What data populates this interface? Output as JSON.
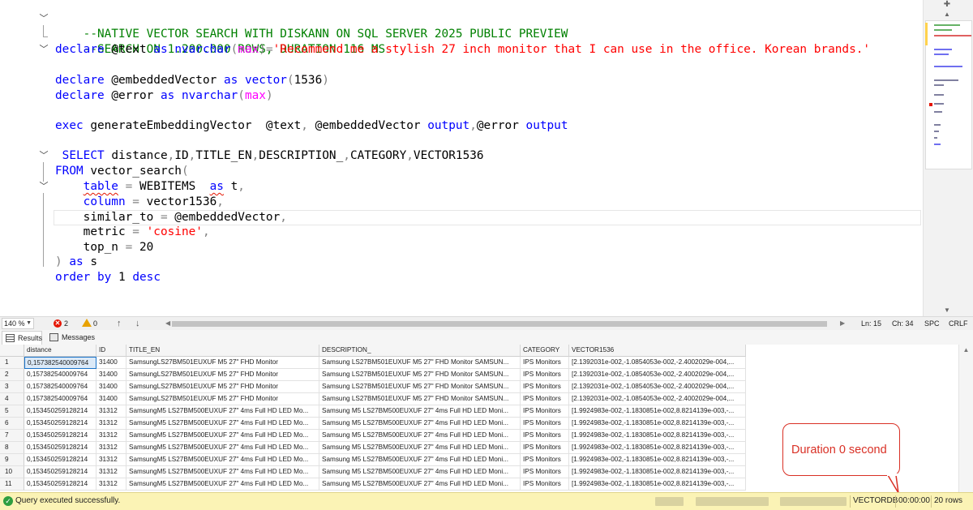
{
  "editor": {
    "comment1": "--NATIVE VECTOR SEARCH WITH DISKANN ON SQL SERVER 2025 PUBLIC PREVIEW",
    "comment2": "--SEARCH ON 1.200.000 ROWS, DURATION 116 MS",
    "line3": {
      "kw1": "declare",
      "var": " @text ",
      "kw2": "as",
      "sp": " ",
      "type": "nvarchar",
      "p1": "(",
      "fn": "max",
      "p2": ")=",
      "str": "'Recommend me a stylish 27 inch monitor that I can use in the office. Korean brands.'"
    },
    "line4": {
      "kw1": "declare",
      "var": " @embeddedVector ",
      "kw2": "as",
      "sp": " ",
      "type": "vector",
      "p1": "(",
      "num": "1536",
      "p2": ")"
    },
    "line5": {
      "kw1": "declare",
      "var": " @error ",
      "kw2": "as",
      "sp": " ",
      "type": "nvarchar",
      "p1": "(",
      "fn": "max",
      "p2": ")"
    },
    "line6": {
      "kw1": "exec",
      "proc": " generateEmbeddingVector  @text",
      "c1": ",",
      "v2": " @embeddedVector ",
      "kw2": "output",
      "c2": ",",
      "v3": "@error ",
      "kw3": "output"
    },
    "line7": {
      "kw1": " SELECT",
      "cols": " distance",
      "c1": ",",
      "a": "ID",
      "c2": ",",
      "b": "TITLE_EN",
      "c3": ",",
      "c": "DESCRIPTION_",
      "c4": ",",
      "d": "CATEGORY",
      "c5": ",",
      "e": "VECTOR1536"
    },
    "line8": {
      "kw1": "FROM",
      "fn": " vector_search",
      "p": "("
    },
    "line9": {
      "indent": "    ",
      "kw1": "table",
      "eq": " = ",
      "name": "WEBITEMS",
      "sp": "  ",
      "kw2": "as",
      "alias": " t",
      "c": ","
    },
    "line10": {
      "indent": "    ",
      "kw1": "column",
      "eq": " = ",
      "name": "vector1536",
      "c": ","
    },
    "line11": {
      "indent": "    ",
      "name": "similar_to",
      "eq": " = ",
      "var": "@embeddedVector",
      "c": ","
    },
    "line12": {
      "indent": "    ",
      "name": "metric",
      "eq": " = ",
      "str": "'cosine'",
      "c": ","
    },
    "line13": {
      "indent": "    ",
      "name": "top_n",
      "eq": " = ",
      "num": "20"
    },
    "line14": {
      "p": ") ",
      "kw1": "as",
      "alias": " s"
    },
    "line15": {
      "kw1": "order",
      "sp": " ",
      "kw2": "by",
      "num": " 1 ",
      "kw3": "desc"
    }
  },
  "editor_status": {
    "zoom": "140 %",
    "errors": "2",
    "warnings": "0",
    "ln": "Ln: 15",
    "ch": "Ch: 34",
    "spc": "SPC",
    "crlf": "CRLF"
  },
  "tabs": {
    "results": "Results",
    "messages": "Messages"
  },
  "grid": {
    "columns": [
      "distance",
      "ID",
      "TITLE_EN",
      "DESCRIPTION_",
      "CATEGORY",
      "VECTOR1536"
    ],
    "rows": [
      {
        "n": "1",
        "distance": "0,157382540009764",
        "id": "31400",
        "title": "SamsungLS27BM501EUXUF M5 27\" FHD Monitor",
        "desc": "Samsung LS27BM501EUXUF M5 27\" FHD Monitor SAMSUN...",
        "cat": "IPS Monitors",
        "vec": "[2.1392031e-002,-1.0854053e-002,-2.4002029e-004,..."
      },
      {
        "n": "2",
        "distance": "0,157382540009764",
        "id": "31400",
        "title": "SamsungLS27BM501EUXUF M5 27\" FHD Monitor",
        "desc": "Samsung LS27BM501EUXUF M5 27\" FHD Monitor SAMSUN...",
        "cat": "IPS Monitors",
        "vec": "[2.1392031e-002,-1.0854053e-002,-2.4002029e-004,..."
      },
      {
        "n": "3",
        "distance": "0,157382540009764",
        "id": "31400",
        "title": "SamsungLS27BM501EUXUF M5 27\" FHD Monitor",
        "desc": "Samsung LS27BM501EUXUF M5 27\" FHD Monitor SAMSUN...",
        "cat": "IPS Monitors",
        "vec": "[2.1392031e-002,-1.0854053e-002,-2.4002029e-004,..."
      },
      {
        "n": "4",
        "distance": "0,157382540009764",
        "id": "31400",
        "title": "SamsungLS27BM501EUXUF M5 27\" FHD Monitor",
        "desc": "Samsung LS27BM501EUXUF M5 27\" FHD Monitor SAMSUN...",
        "cat": "IPS Monitors",
        "vec": "[2.1392031e-002,-1.0854053e-002,-2.4002029e-004,..."
      },
      {
        "n": "5",
        "distance": "0,153450259128214",
        "id": "31312",
        "title": "SamsungM5 LS27BM500EUXUF 27\" 4ms Full HD LED Mo...",
        "desc": "Samsung M5 LS27BM500EUXUF 27\" 4ms Full HD LED Moni...",
        "cat": "IPS Monitors",
        "vec": "[1.9924983e-002,-1.1830851e-002,8.8214139e-003,-..."
      },
      {
        "n": "6",
        "distance": "0,153450259128214",
        "id": "31312",
        "title": "SamsungM5 LS27BM500EUXUF 27\" 4ms Full HD LED Mo...",
        "desc": "Samsung M5 LS27BM500EUXUF 27\" 4ms Full HD LED Moni...",
        "cat": "IPS Monitors",
        "vec": "[1.9924983e-002,-1.1830851e-002,8.8214139e-003,-..."
      },
      {
        "n": "7",
        "distance": "0,153450259128214",
        "id": "31312",
        "title": "SamsungM5 LS27BM500EUXUF 27\" 4ms Full HD LED Mo...",
        "desc": "Samsung M5 LS27BM500EUXUF 27\" 4ms Full HD LED Moni...",
        "cat": "IPS Monitors",
        "vec": "[1.9924983e-002,-1.1830851e-002,8.8214139e-003,-..."
      },
      {
        "n": "8",
        "distance": "0,153450259128214",
        "id": "31312",
        "title": "SamsungM5 LS27BM500EUXUF 27\" 4ms Full HD LED Mo...",
        "desc": "Samsung M5 LS27BM500EUXUF 27\" 4ms Full HD LED Moni...",
        "cat": "IPS Monitors",
        "vec": "[1.9924983e-002,-1.1830851e-002,8.8214139e-003,-..."
      },
      {
        "n": "9",
        "distance": "0,153450259128214",
        "id": "31312",
        "title": "SamsungM5 LS27BM500EUXUF 27\" 4ms Full HD LED Mo...",
        "desc": "Samsung M5 LS27BM500EUXUF 27\" 4ms Full HD LED Moni...",
        "cat": "IPS Monitors",
        "vec": "[1.9924983e-002,-1.1830851e-002,8.8214139e-003,-..."
      },
      {
        "n": "10",
        "distance": "0,153450259128214",
        "id": "31312",
        "title": "SamsungM5 LS27BM500EUXUF 27\" 4ms Full HD LED Mo...",
        "desc": "Samsung M5 LS27BM500EUXUF 27\" 4ms Full HD LED Moni...",
        "cat": "IPS Monitors",
        "vec": "[1.9924983e-002,-1.1830851e-002,8.8214139e-003,-..."
      },
      {
        "n": "11",
        "distance": "0,153450259128214",
        "id": "31312",
        "title": "SamsungM5 LS27BM500EUXUF 27\" 4ms Full HD LED Mo...",
        "desc": "Samsung M5 LS27BM500EUXUF 27\" 4ms Full HD LED Moni...",
        "cat": "IPS Monitors",
        "vec": "[1.9924983e-002,-1.1830851e-002,8.8214139e-003,-..."
      }
    ]
  },
  "callout": {
    "text": "Duration 0 second"
  },
  "statusbar": {
    "message": "Query executed successfully.",
    "database": "VECTORDB",
    "elapsed": "00:00:00",
    "rows": "20 rows"
  },
  "icons": {
    "collapse": "chevron-down-icon",
    "error": "error-icon",
    "warning": "warning-icon",
    "success": "check-circle-icon"
  },
  "colors": {
    "keyword": "#0000ff",
    "comment": "#008000",
    "string": "#ff0000",
    "function": "#ff00ff",
    "status_bar": "#fbf3b5",
    "callout": "#d93025"
  }
}
